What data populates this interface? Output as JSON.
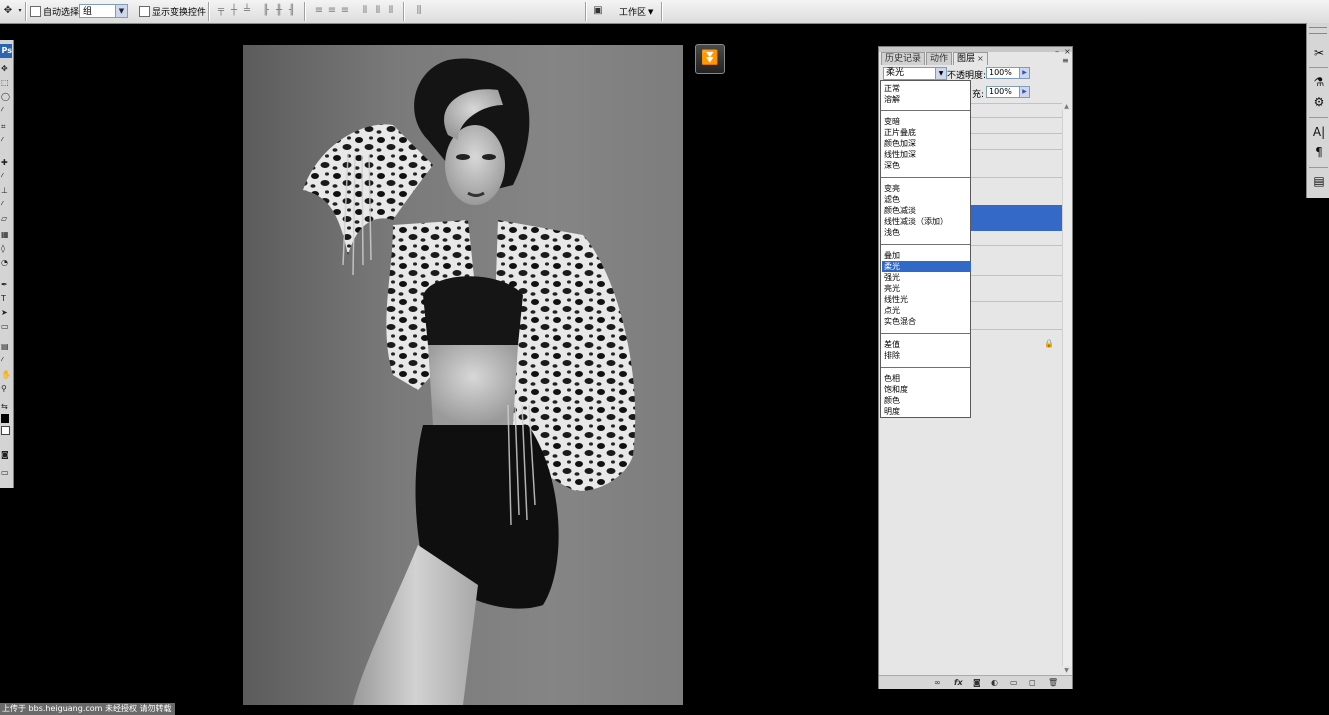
{
  "options_bar": {
    "auto_select_label": "自动选择:",
    "auto_select_value": "组",
    "show_transform_label": "显示变换控件",
    "workspace_label": "工作区"
  },
  "toolbox": {
    "logo": "Ps"
  },
  "layers_panel": {
    "tabs": [
      {
        "label": "历史记录"
      },
      {
        "label": "动作"
      },
      {
        "label": "图层"
      }
    ],
    "blend_mode": "柔光",
    "opacity_label": "不透明度:",
    "opacity_value": "100%",
    "fill_label": "充:",
    "fill_value": "100%"
  },
  "blend_dropdown": {
    "items": [
      "正常",
      "溶解",
      "变暗",
      "正片叠底",
      "颜色加深",
      "线性加深",
      "深色",
      "变亮",
      "滤色",
      "颜色减淡",
      "线性减淡（添加）",
      "浅色",
      "叠加",
      "柔光",
      "强光",
      "亮光",
      "线性光",
      "点光",
      "实色混合",
      "差值",
      "排除",
      "色相",
      "饱和度",
      "颜色",
      "明度"
    ],
    "selected": "柔光"
  },
  "watermark": {
    "text": "上传于 bbs.heiguang.com  未经授权  请勿转载"
  },
  "icons": {
    "move_tool": "move-icon",
    "collapse": "double-chevron-down-icon",
    "lock": "lock-icon",
    "workspace_camera": "camera-icon"
  }
}
